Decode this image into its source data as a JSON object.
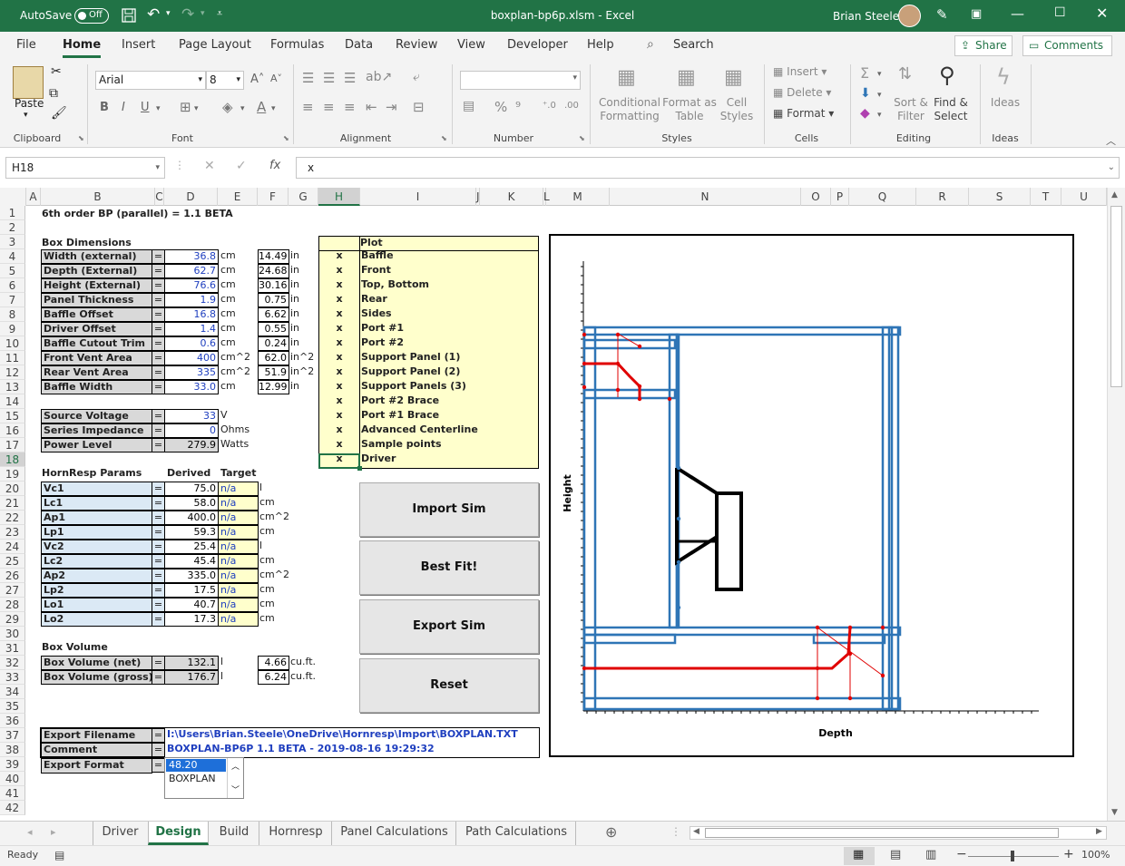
{
  "titlebar": {
    "autosave_label": "AutoSave",
    "autosave_state": "Off",
    "filename": "boxplan-bp6p.xlsm",
    "app": "Excel",
    "user": "Brian Steele"
  },
  "ribbon_tabs": [
    "File",
    "Home",
    "Insert",
    "Page Layout",
    "Formulas",
    "Data",
    "Review",
    "View",
    "Developer",
    "Help"
  ],
  "search_label": "Search",
  "share_label": "Share",
  "comments_label": "Comments",
  "ribbon": {
    "paste": "Paste",
    "clipboard": "Clipboard",
    "font_name": "Arial",
    "font_size": "8",
    "font": "Font",
    "alignment": "Alignment",
    "number": "Number",
    "conditional": [
      "Conditional",
      "Formatting"
    ],
    "format_as": [
      "Format as",
      "Table"
    ],
    "cell_styles": [
      "Cell",
      "Styles"
    ],
    "styles": "Styles",
    "insert": "Insert",
    "delete": "Delete",
    "format": "Format",
    "cells": "Cells",
    "sort": [
      "Sort &",
      "Filter"
    ],
    "find": [
      "Find &",
      "Select"
    ],
    "editing": "Editing",
    "ideas": "Ideas",
    "ideas_group": "Ideas",
    "bold": "B",
    "italic": "I",
    "underline": "U"
  },
  "namebox": "H18",
  "formula": "x",
  "columns": [
    "A",
    "B",
    "C",
    "D",
    "E",
    "F",
    "G",
    "H",
    "I",
    "J",
    "K",
    "L",
    "M",
    "N",
    "O",
    "P",
    "Q",
    "R",
    "S",
    "T",
    "U"
  ],
  "rows": [
    "1",
    "2",
    "3",
    "4",
    "5",
    "6",
    "7",
    "8",
    "9",
    "10",
    "11",
    "12",
    "13",
    "14",
    "15",
    "16",
    "17",
    "18",
    "19",
    "20",
    "21",
    "22",
    "23",
    "24",
    "25",
    "26",
    "27",
    "28",
    "29",
    "30",
    "31",
    "32",
    "33",
    "34",
    "35",
    "36",
    "37",
    "38",
    "39",
    "40",
    "41",
    "42"
  ],
  "sheet": {
    "title": "6th order BP (parallel)  =  1.1 BETA",
    "box_dim_header": "Box Dimensions",
    "box_dims": [
      {
        "label": "Width (external)",
        "eq": "=",
        "value": "36.8",
        "unit": "cm",
        "in": "14.49",
        "in_unit": "in"
      },
      {
        "label": "Depth (External)",
        "eq": "=",
        "value": "62.7",
        "unit": "cm",
        "in": "24.68",
        "in_unit": "in"
      },
      {
        "label": "Height (External)",
        "eq": "=",
        "value": "76.6",
        "unit": "cm",
        "in": "30.16",
        "in_unit": "in"
      },
      {
        "label": "Panel Thickness",
        "eq": "=",
        "value": "1.9",
        "unit": "cm",
        "in": "0.75",
        "in_unit": "in"
      },
      {
        "label": "Baffle Offset",
        "eq": "=",
        "value": "16.8",
        "unit": "cm",
        "in": "6.62",
        "in_unit": "in"
      },
      {
        "label": "Driver Offset",
        "eq": "=",
        "value": "1.4",
        "unit": "cm",
        "in": "0.55",
        "in_unit": "in"
      },
      {
        "label": "Baffle Cutout Trim",
        "eq": "=",
        "value": "0.6",
        "unit": "cm",
        "in": "0.24",
        "in_unit": "in"
      },
      {
        "label": "Front Vent Area",
        "eq": "=",
        "value": "400",
        "unit": "cm^2",
        "in": "62.0",
        "in_unit": "in^2"
      },
      {
        "label": "Rear Vent Area",
        "eq": "=",
        "value": "335",
        "unit": "cm^2",
        "in": "51.9",
        "in_unit": "in^2"
      },
      {
        "label": "Baffle Width",
        "eq": "=",
        "value": "33.0",
        "unit": "cm",
        "in": "12.99",
        "in_unit": "in"
      }
    ],
    "power": [
      {
        "label": "Source Voltage",
        "eq": "=",
        "value": "33",
        "unit": "V"
      },
      {
        "label": "Series Impedance",
        "eq": "=",
        "value": "0",
        "unit": "Ohms"
      },
      {
        "label": "Power Level",
        "eq": "=",
        "value": "279.9",
        "unit": "Watts"
      }
    ],
    "hr_header": "HornResp Params",
    "hr_derived": "Derived",
    "hr_target": "Target",
    "hornresp": [
      {
        "label": "Vc1",
        "value": "75.0",
        "target": "n/a",
        "unit": "l"
      },
      {
        "label": "Lc1",
        "value": "58.0",
        "target": "n/a",
        "unit": "cm"
      },
      {
        "label": "Ap1",
        "value": "400.0",
        "target": "n/a",
        "unit": "cm^2"
      },
      {
        "label": "Lp1",
        "value": "59.3",
        "target": "n/a",
        "unit": "cm"
      },
      {
        "label": "Vc2",
        "value": "25.4",
        "target": "n/a",
        "unit": "l"
      },
      {
        "label": "Lc2",
        "value": "45.4",
        "target": "n/a",
        "unit": "cm"
      },
      {
        "label": "Ap2",
        "value": "335.0",
        "target": "n/a",
        "unit": "cm^2"
      },
      {
        "label": "Lp2",
        "value": "17.5",
        "target": "n/a",
        "unit": "cm"
      },
      {
        "label": "Lo1",
        "value": "40.7",
        "target": "n/a",
        "unit": "cm"
      },
      {
        "label": "Lo2",
        "value": "17.3",
        "target": "n/a",
        "unit": "cm"
      }
    ],
    "volume_header": "Box Volume",
    "volume": [
      {
        "label": "Box Volume (net)",
        "value": "132.1",
        "unit": "l",
        "cuft": "4.66",
        "cuft_unit": "cu.ft."
      },
      {
        "label": "Box Volume (gross)",
        "value": "176.7",
        "unit": "l",
        "cuft": "6.24",
        "cuft_unit": "cu.ft."
      }
    ],
    "export": [
      {
        "label": "Export Filename",
        "value": "I:\\Users\\Brian.Steele\\OneDrive\\Hornresp\\Import\\BOXPLAN.TXT"
      },
      {
        "label": "Comment",
        "value": "BOXPLAN-BP6P 1.1 BETA - 2019-08-16 19:29:32"
      },
      {
        "label": "Export Format",
        "value": ""
      }
    ],
    "format_options": [
      "48.20",
      "BOXPLAN"
    ],
    "plot_header": "Plot",
    "plot_items": [
      {
        "mark": "x",
        "name": "Baffle"
      },
      {
        "mark": "x",
        "name": "Front"
      },
      {
        "mark": "x",
        "name": "Top, Bottom"
      },
      {
        "mark": "x",
        "name": "Rear"
      },
      {
        "mark": "x",
        "name": "Sides"
      },
      {
        "mark": "x",
        "name": "Port #1"
      },
      {
        "mark": "x",
        "name": "Port #2"
      },
      {
        "mark": "x",
        "name": "Support Panel (1)"
      },
      {
        "mark": "x",
        "name": "Support Panel (2)"
      },
      {
        "mark": "x",
        "name": "Support Panels (3)"
      },
      {
        "mark": "x",
        "name": "Port #2 Brace"
      },
      {
        "mark": "x",
        "name": "Port #1 Brace"
      },
      {
        "mark": "x",
        "name": "Advanced Centerline"
      },
      {
        "mark": "x",
        "name": "Sample points"
      },
      {
        "mark": "x",
        "name": "Driver"
      }
    ],
    "buttons": [
      "Import Sim",
      "Best Fit!",
      "Export Sim",
      "Reset"
    ],
    "chart": {
      "xlabel": "Depth",
      "ylabel": "Height"
    }
  },
  "sheet_tabs": [
    "Driver",
    "Design",
    "Build",
    "Hornresp",
    "Panel Calculations",
    "Path Calculations"
  ],
  "active_sheet": "Design",
  "status": {
    "ready": "Ready",
    "zoom": "100%"
  },
  "colors": {
    "excel_green": "#217346",
    "label_gray": "#d9d9d9",
    "label_blue": "#dbe9f5",
    "yellow": "#ffffcc",
    "value_blue": "#1f3fbf",
    "panel_blue": "#2e75b6",
    "port_red": "#e00000"
  }
}
